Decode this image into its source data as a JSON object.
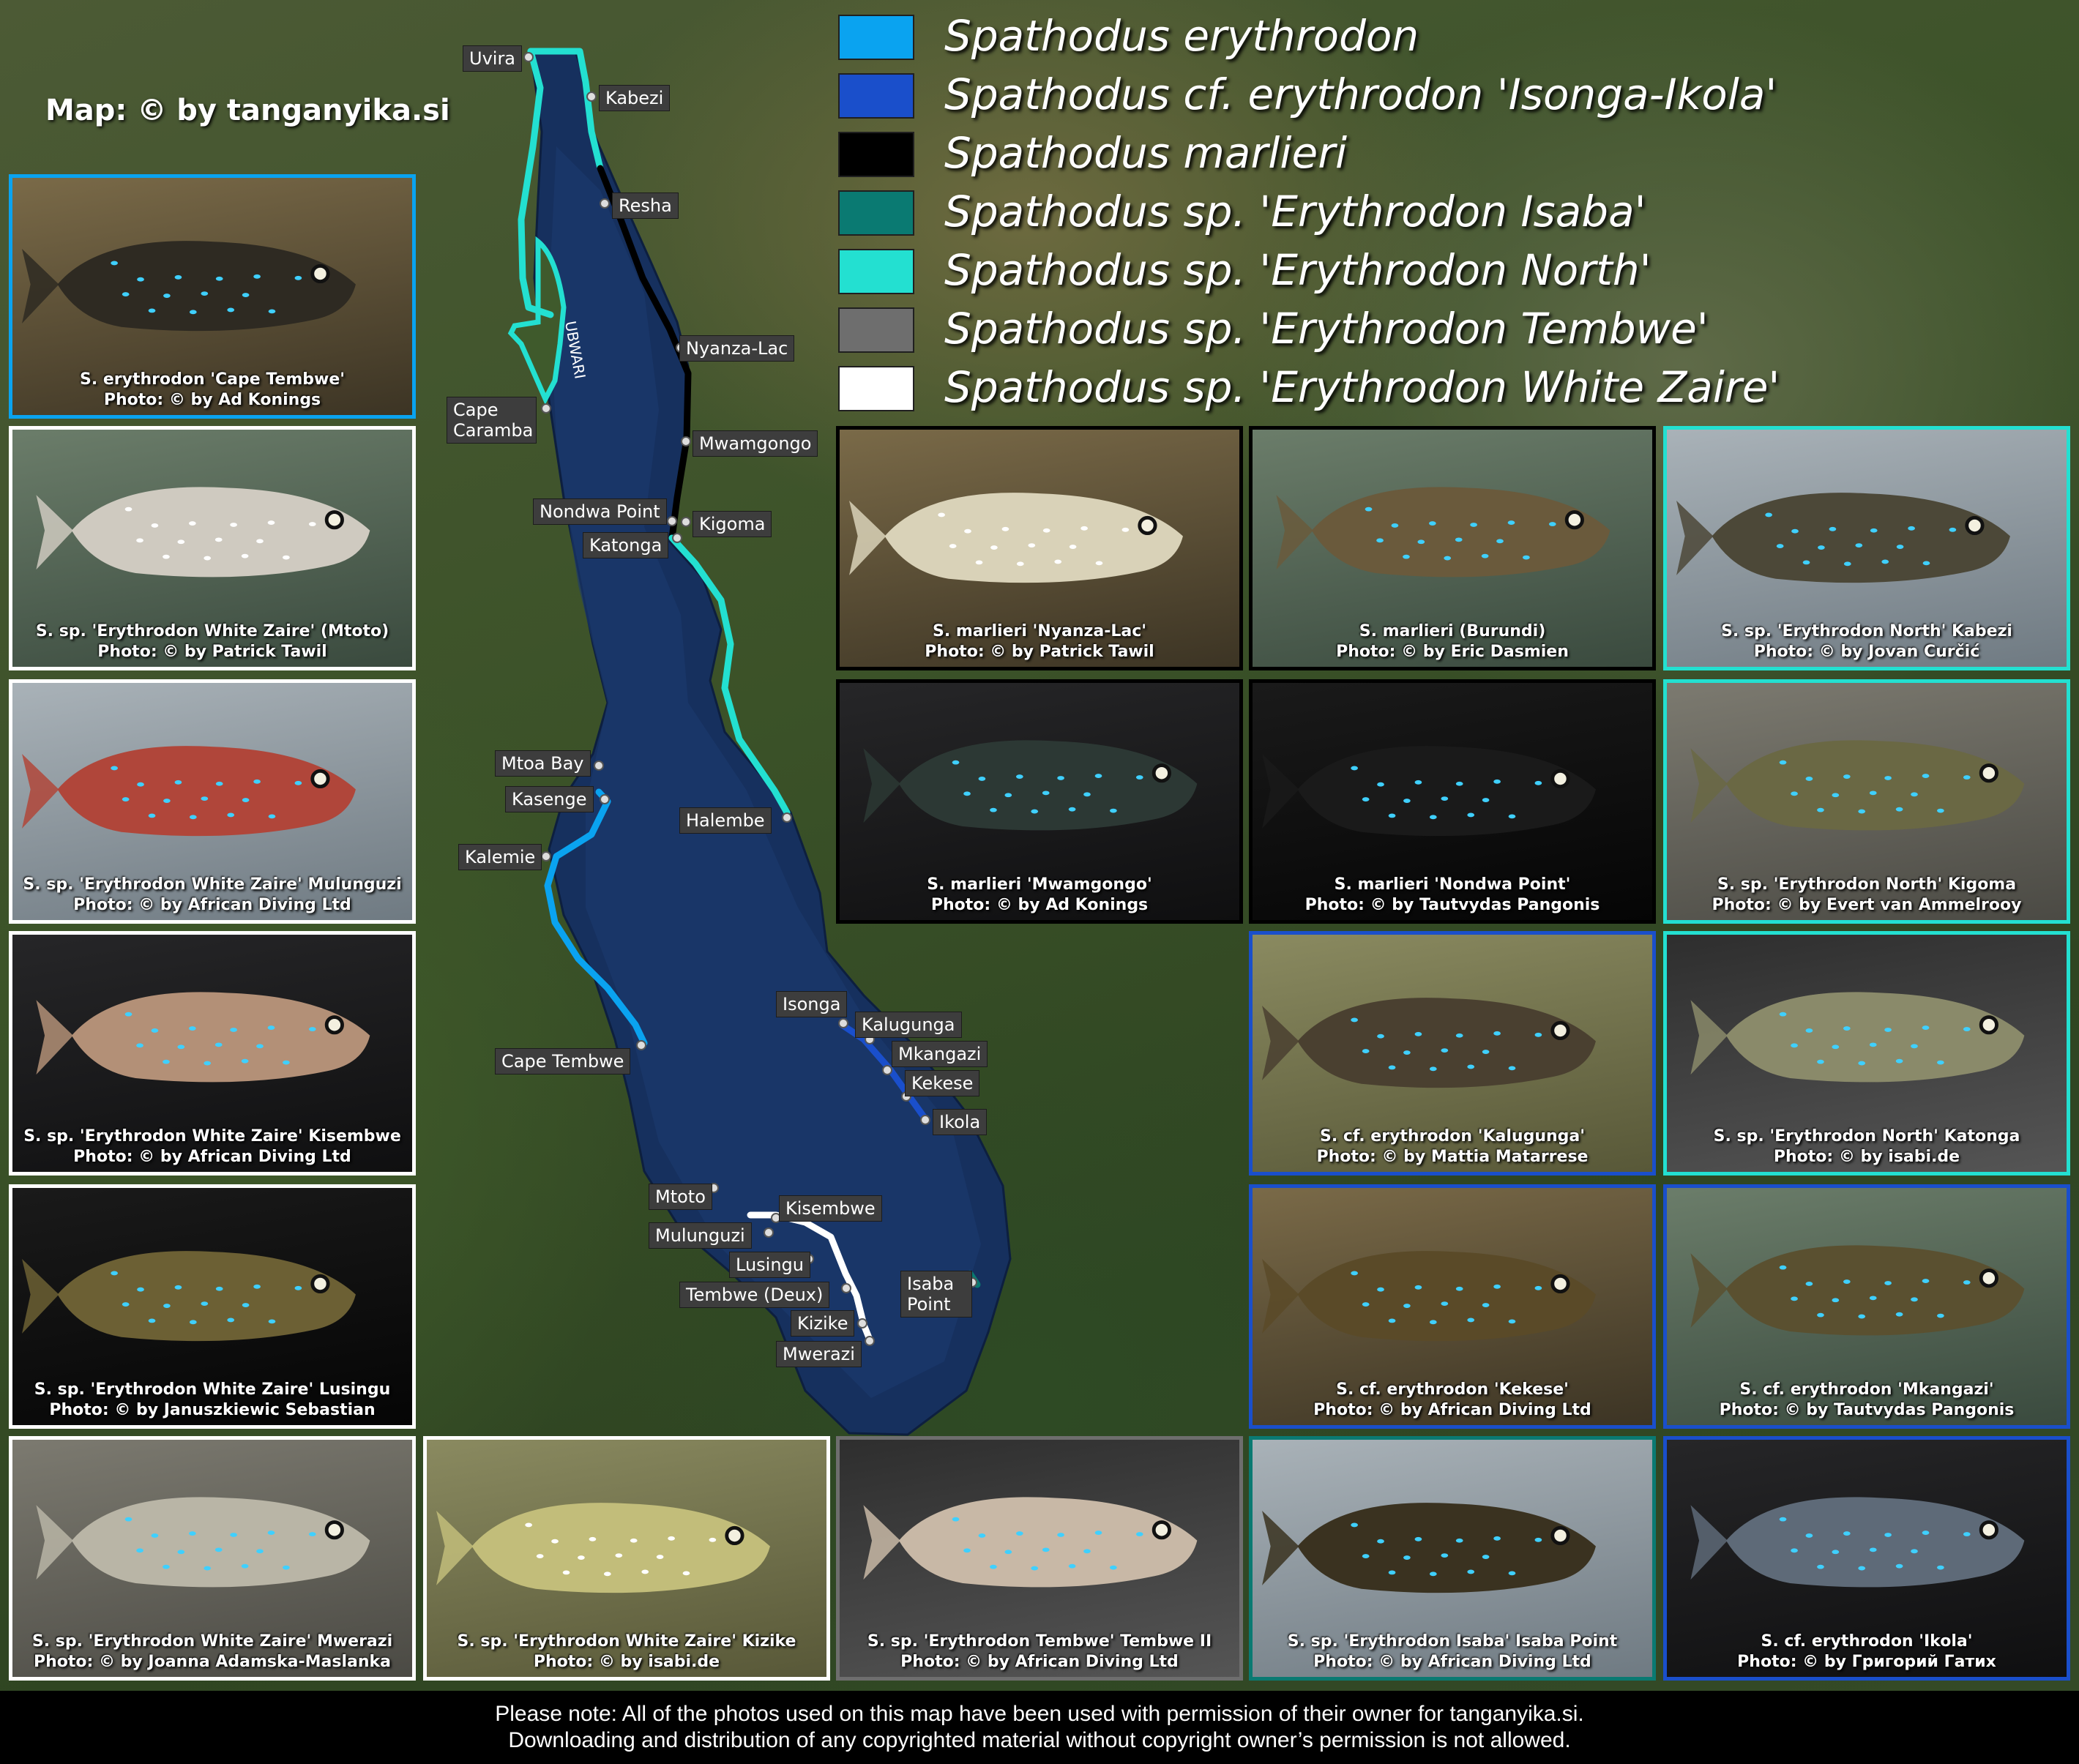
{
  "map_credit": "Map: © by tanganyika.si",
  "legend": [
    {
      "label": "Spathodus erythrodon",
      "color": "#0aa3f0"
    },
    {
      "label": "Spathodus cf. erythrodon 'Isonga-Ikola'",
      "color": "#1a4fcb"
    },
    {
      "label": "Spathodus marlieri",
      "color": "#000000"
    },
    {
      "label": "Spathodus sp. 'Erythrodon Isaba'",
      "color": "#0a7a72"
    },
    {
      "label": "Spathodus sp. 'Erythrodon North'",
      "color": "#23e0d1"
    },
    {
      "label": "Spathodus sp. 'Erythrodon Tembwe'",
      "color": "#6e6e6e"
    },
    {
      "label": "Spathodus sp. 'Erythrodon White Zaire'",
      "color": "#ffffff"
    }
  ],
  "places": [
    "Uvira",
    "Kabezi",
    "Resha",
    "Nyanza-Lac",
    "Mwamgongo",
    "Cape Caramba",
    "Nondwa Point",
    "Kigoma",
    "Katonga",
    "Mtoa Bay",
    "Kasenge",
    "Kalemie",
    "Halembe",
    "Cape Tembwe",
    "Isonga",
    "Kalugunga",
    "Mkangazi",
    "Kekese",
    "Ikola",
    "Mtoto",
    "Kisembwe",
    "Mulunguzi",
    "Lusingu",
    "Tembwe (Deux)",
    "Isaba Point",
    "Kizike",
    "Mwerazi"
  ],
  "river_label": "UBWARI",
  "photos": [
    {
      "caption1": "S. erythrodon 'Cape Tembwe'",
      "caption2": "Photo: © by Ad Konings",
      "border": "#0aa3f0"
    },
    {
      "caption1": "S. sp. 'Erythrodon White Zaire' (Mtoto)",
      "caption2": "Photo: © by Patrick Tawil",
      "border": "#ffffff"
    },
    {
      "caption1": "S. sp. 'Erythrodon White Zaire' Mulunguzi",
      "caption2": "Photo: © by African Diving Ltd",
      "border": "#ffffff"
    },
    {
      "caption1": "S. sp. 'Erythrodon White Zaire' Kisembwe",
      "caption2": "Photo: © by African Diving Ltd",
      "border": "#ffffff"
    },
    {
      "caption1": "S. sp. 'Erythrodon White Zaire' Lusingu",
      "caption2": "Photo: © by Januszkiewic Sebastian",
      "border": "#ffffff"
    },
    {
      "caption1": "S. sp. 'Erythrodon White Zaire' Mwerazi",
      "caption2": "Photo: © by Joanna Adamska-Maslanka",
      "border": "#ffffff"
    },
    {
      "caption1": "S. sp. 'Erythrodon White Zaire' Kizike",
      "caption2": "Photo: © by isabi.de",
      "border": "#ffffff"
    },
    {
      "caption1": "S. sp. 'Erythrodon Tembwe' Tembwe II",
      "caption2": "Photo: © by African Diving Ltd",
      "border": "#6e6e6e"
    },
    {
      "caption1": "S. marlieri 'Nyanza-Lac'",
      "caption2": "Photo: © by Patrick Tawil",
      "border": "#000000"
    },
    {
      "caption1": "S. marlieri (Burundi)",
      "caption2": "Photo: © by Eric Dasmien",
      "border": "#000000"
    },
    {
      "caption1": "S. sp. 'Erythrodon North' Kabezi",
      "caption2": "Photo: © by Jovan Curčić",
      "border": "#23e0d1"
    },
    {
      "caption1": "S. marlieri 'Mwamgongo'",
      "caption2": "Photo: © by Ad Konings",
      "border": "#000000"
    },
    {
      "caption1": "S. marlieri 'Nondwa Point'",
      "caption2": "Photo: © by Tautvydas Pangonis",
      "border": "#000000"
    },
    {
      "caption1": "S. sp. 'Erythrodon North' Kigoma",
      "caption2": "Photo: © by Evert van Ammelrooy",
      "border": "#23e0d1"
    },
    {
      "caption1": "S. cf. erythrodon 'Kalugunga'",
      "caption2": "Photo: © by Mattia Matarrese",
      "border": "#1a4fcb"
    },
    {
      "caption1": "S. sp. 'Erythrodon North' Katonga",
      "caption2": "Photo: © by isabi.de",
      "border": "#23e0d1"
    },
    {
      "caption1": "S. cf. erythrodon 'Kekese'",
      "caption2": "Photo: © by African Diving Ltd",
      "border": "#1a4fcb"
    },
    {
      "caption1": "S. cf. erythrodon 'Mkangazi'",
      "caption2": "Photo: © by Tautvydas Pangonis",
      "border": "#1a4fcb"
    },
    {
      "caption1": "S. sp. 'Erythrodon Isaba' Isaba Point",
      "caption2": "Photo: © by African Diving Ltd",
      "border": "#0a7a72"
    },
    {
      "caption1": "S. cf. erythrodon 'Ikola'",
      "caption2": "Photo: © by Григорий Гатих",
      "border": "#1a4fcb"
    }
  ],
  "footer": {
    "line1": "Please note: All of the photos used on this map have been used with permission of their owner for tanganyika.si.",
    "line2": "Downloading and distribution of any copyrighted material without copyright owner’s permission is not allowed."
  }
}
